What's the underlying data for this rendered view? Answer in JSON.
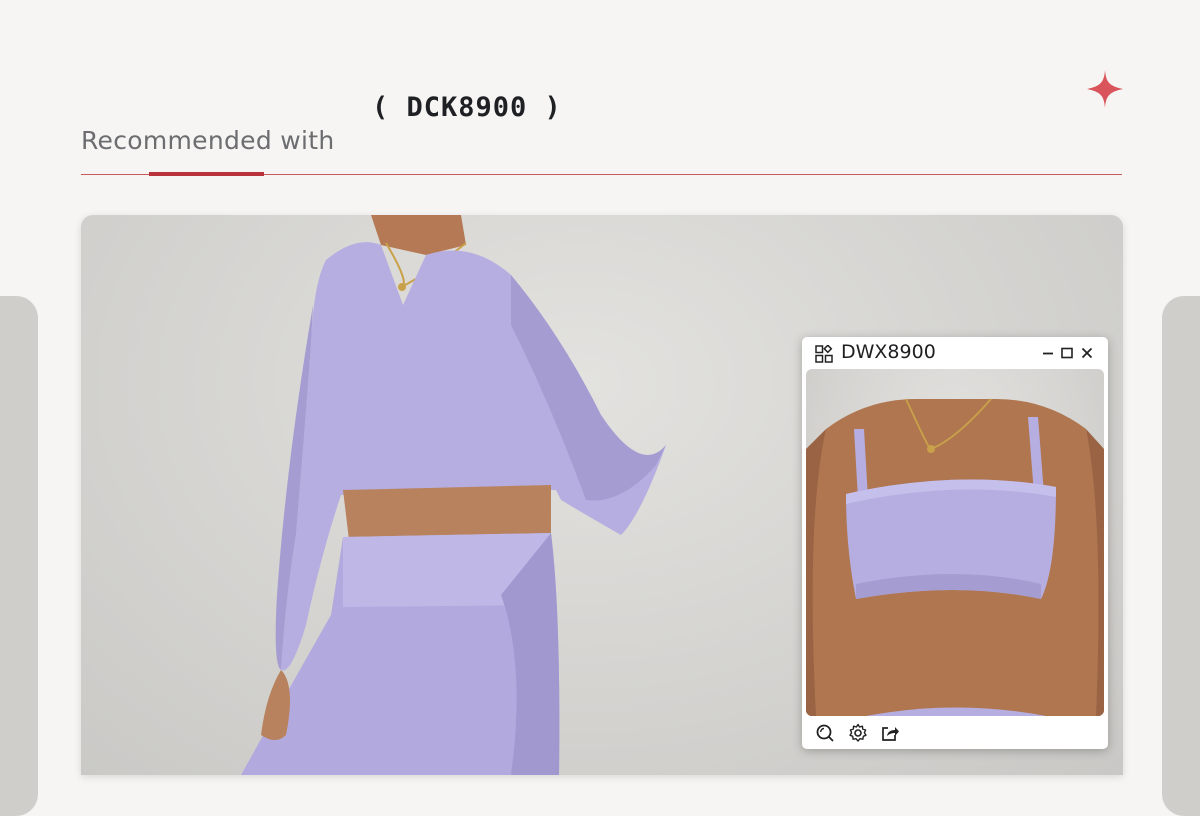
{
  "header": {
    "product_code": "( DCK8900 )",
    "section_title": "Recommended with"
  },
  "colors": {
    "background": "#f7f5f3",
    "accent_red": "#b8333a",
    "sparkle": "#d9555b",
    "garment_lavender": "#b6aee0",
    "photo_backdrop": "#d7d6d3"
  },
  "main_image": {
    "alt": "Model wearing lavender long-sleeve crop top and leggings"
  },
  "popup": {
    "title": "DWX8900",
    "app_icon": "grid-apps-icon",
    "window_controls": [
      "minimize-icon",
      "maximize-icon",
      "close-icon"
    ],
    "image_alt": "Lavender sports bra",
    "toolbar_icons": [
      "search-zoom-icon",
      "settings-gear-icon",
      "share-icon"
    ]
  }
}
